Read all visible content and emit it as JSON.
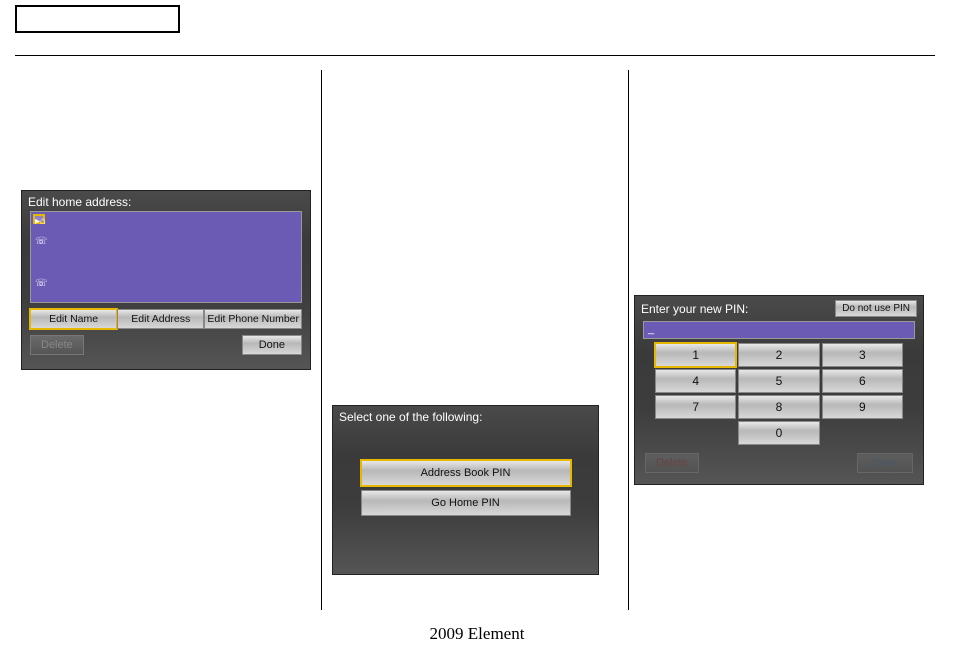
{
  "footer": "2009  Element",
  "home": {
    "title": "Edit home address:",
    "buttons": {
      "edit_name": "Edit Name",
      "edit_address": "Edit Address",
      "edit_phone": "Edit Phone Number"
    },
    "delete": "Delete",
    "done": "Done"
  },
  "select": {
    "title": "Select one of the following:",
    "options": {
      "address_book": "Address Book PIN",
      "go_home": "Go Home PIN"
    }
  },
  "pin": {
    "label": "Enter your new PIN:",
    "do_not_use": "Do not use PIN",
    "display": "_",
    "keys": [
      "1",
      "2",
      "3",
      "4",
      "5",
      "6",
      "7",
      "8",
      "9",
      "0"
    ],
    "delete": "Delete",
    "done": "Done"
  }
}
